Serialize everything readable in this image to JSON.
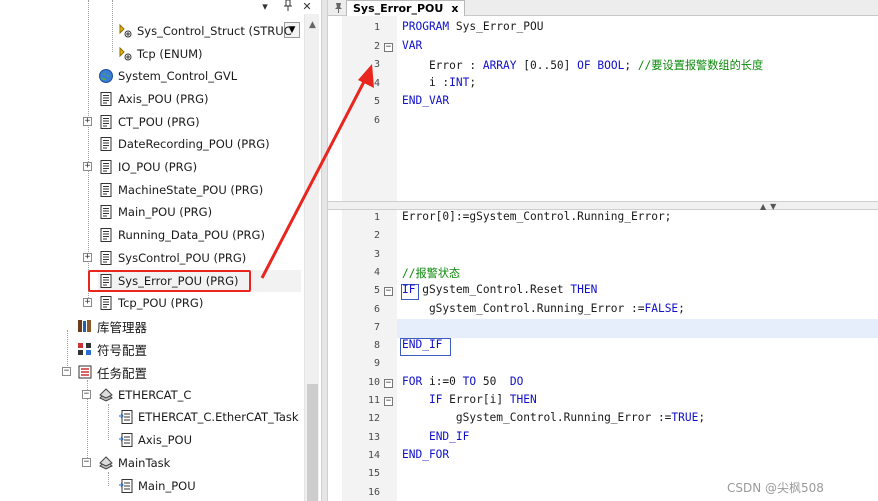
{
  "tree": {
    "items": [
      {
        "label": "Sys_Control_Struct (STRUC",
        "icon": "struct-icon"
      },
      {
        "label": "Tcp (ENUM)",
        "icon": "enum-icon"
      },
      {
        "label": "System_Control_GVL",
        "icon": "globe-icon"
      },
      {
        "label": "Axis_POU (PRG)",
        "icon": "pou-icon"
      },
      {
        "label": "CT_POU (PRG)",
        "icon": "pou-icon"
      },
      {
        "label": "DateRecording_POU (PRG)",
        "icon": "pou-icon"
      },
      {
        "label": "IO_POU (PRG)",
        "icon": "pou-icon"
      },
      {
        "label": "MachineState_POU (PRG)",
        "icon": "pou-icon"
      },
      {
        "label": "Main_POU (PRG)",
        "icon": "pou-icon"
      },
      {
        "label": "Running_Data_POU (PRG)",
        "icon": "pou-icon"
      },
      {
        "label": "SysControl_POU (PRG)",
        "icon": "pou-icon"
      },
      {
        "label": "Sys_Error_POU (PRG)",
        "icon": "pou-icon"
      },
      {
        "label": "Tcp_POU (PRG)",
        "icon": "pou-icon"
      },
      {
        "label": "库管理器",
        "icon": "library-icon"
      },
      {
        "label": "符号配置",
        "icon": "symbol-config-icon"
      },
      {
        "label": "任务配置",
        "icon": "task-config-icon"
      },
      {
        "label": "ETHERCAT_C",
        "icon": "task-icon"
      },
      {
        "label": "ETHERCAT_C.EtherCAT_Task",
        "icon": "program-call-icon"
      },
      {
        "label": "Axis_POU",
        "icon": "program-call-icon"
      },
      {
        "label": "MainTask",
        "icon": "task-icon"
      },
      {
        "label": "Main_POU",
        "icon": "program-call-icon"
      }
    ],
    "panel_buttons": {
      "dropdown": "▾",
      "pin": "ᵖ",
      "close": "✕"
    }
  },
  "editor": {
    "tab_label": "Sys_Error_POU",
    "tab_close": "x",
    "decl_lines": [
      {
        "n": "1",
        "fold": "",
        "parts": [
          [
            "kw",
            "PROGRAM"
          ],
          [
            "nm",
            " Sys_Error_POU"
          ]
        ]
      },
      {
        "n": "2",
        "fold": "−",
        "parts": [
          [
            "kw",
            "VAR"
          ]
        ]
      },
      {
        "n": "3",
        "fold": "",
        "parts": [
          [
            "nm",
            "    Error : "
          ],
          [
            "kw",
            "ARRAY"
          ],
          [
            "nm",
            " [0..50] "
          ],
          [
            "kw",
            "OF"
          ],
          [
            "nm",
            " "
          ],
          [
            "kw",
            "BOOL"
          ],
          [
            "nm",
            "; "
          ],
          [
            "cm",
            "//要设置报警数组的长度"
          ]
        ]
      },
      {
        "n": "4",
        "fold": "",
        "parts": [
          [
            "nm",
            "    i :"
          ],
          [
            "kw",
            "INT"
          ],
          [
            "nm",
            ";"
          ]
        ]
      },
      {
        "n": "5",
        "fold": "",
        "parts": [
          [
            "kw",
            "END_VAR"
          ]
        ]
      },
      {
        "n": "6",
        "fold": "",
        "parts": []
      }
    ],
    "impl_lines": [
      {
        "n": "1",
        "fold": "",
        "parts": [
          [
            "nm",
            "Error[0]:=gSystem_Control.Running_Error;"
          ]
        ]
      },
      {
        "n": "2",
        "fold": "",
        "parts": []
      },
      {
        "n": "3",
        "fold": "",
        "parts": []
      },
      {
        "n": "4",
        "fold": "",
        "parts": [
          [
            "cm",
            "//报警状态"
          ]
        ]
      },
      {
        "n": "5",
        "fold": "−",
        "parts": [
          [
            "kw",
            "IF"
          ],
          [
            "nm",
            " gSystem_Control.Reset "
          ],
          [
            "kw",
            "THEN"
          ]
        ]
      },
      {
        "n": "6",
        "fold": "",
        "parts": [
          [
            "nm",
            "    gSystem_Control.Running_Error :="
          ],
          [
            "kw",
            "FALSE"
          ],
          [
            "nm",
            ";"
          ]
        ]
      },
      {
        "n": "7",
        "fold": "",
        "parts": []
      },
      {
        "n": "8",
        "fold": "",
        "parts": [
          [
            "kw",
            "END_IF"
          ]
        ]
      },
      {
        "n": "9",
        "fold": "",
        "parts": []
      },
      {
        "n": "10",
        "fold": "−",
        "parts": [
          [
            "kw",
            "FOR"
          ],
          [
            "nm",
            " i:="
          ],
          [
            "nm",
            "0"
          ],
          [
            "nm",
            " "
          ],
          [
            "kw",
            "TO"
          ],
          [
            "nm",
            " 50  "
          ],
          [
            "kw",
            "DO"
          ]
        ]
      },
      {
        "n": "11",
        "fold": "−",
        "parts": [
          [
            "nm",
            "    "
          ],
          [
            "kw",
            "IF"
          ],
          [
            "nm",
            " Error[i] "
          ],
          [
            "kw",
            "THEN"
          ]
        ]
      },
      {
        "n": "12",
        "fold": "",
        "parts": [
          [
            "nm",
            "        gSystem_Control.Running_Error :="
          ],
          [
            "kw",
            "TRUE"
          ],
          [
            "nm",
            ";"
          ]
        ]
      },
      {
        "n": "13",
        "fold": "",
        "parts": [
          [
            "nm",
            "    "
          ],
          [
            "kw",
            "END_IF"
          ]
        ]
      },
      {
        "n": "14",
        "fold": "",
        "parts": [
          [
            "kw",
            "END_FOR"
          ]
        ]
      },
      {
        "n": "15",
        "fold": "",
        "parts": []
      },
      {
        "n": "16",
        "fold": "",
        "parts": []
      }
    ],
    "divider_arrows": "▲▼"
  },
  "watermark": "CSDN @尖枫508",
  "colors": {
    "keyword": "#1010c8",
    "comment": "#0a8a0a",
    "annotation": "#e8261e"
  }
}
